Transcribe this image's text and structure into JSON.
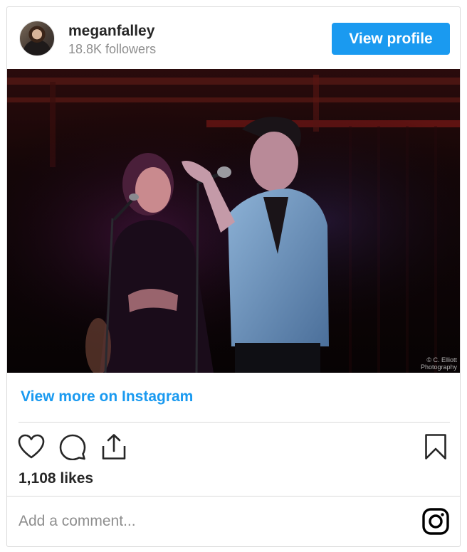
{
  "header": {
    "username": "meganfalley",
    "followers": "18.8K followers",
    "view_profile_label": "View profile"
  },
  "post": {
    "image_credit_line1": "© C. Elliott",
    "image_credit_line2": "Photography",
    "view_more_label": "View more on Instagram",
    "likes": "1,108 likes",
    "comment_placeholder": "Add a comment..."
  },
  "icons": {
    "avatar": "avatar",
    "like": "heart-icon",
    "comment": "comment-bubble-icon",
    "share": "share-icon",
    "save": "bookmark-icon",
    "brand": "instagram-logo-icon"
  },
  "colors": {
    "accent": "#1a9af0",
    "text": "#262626",
    "muted": "#8e8e8e",
    "border": "#dbdbdb"
  }
}
